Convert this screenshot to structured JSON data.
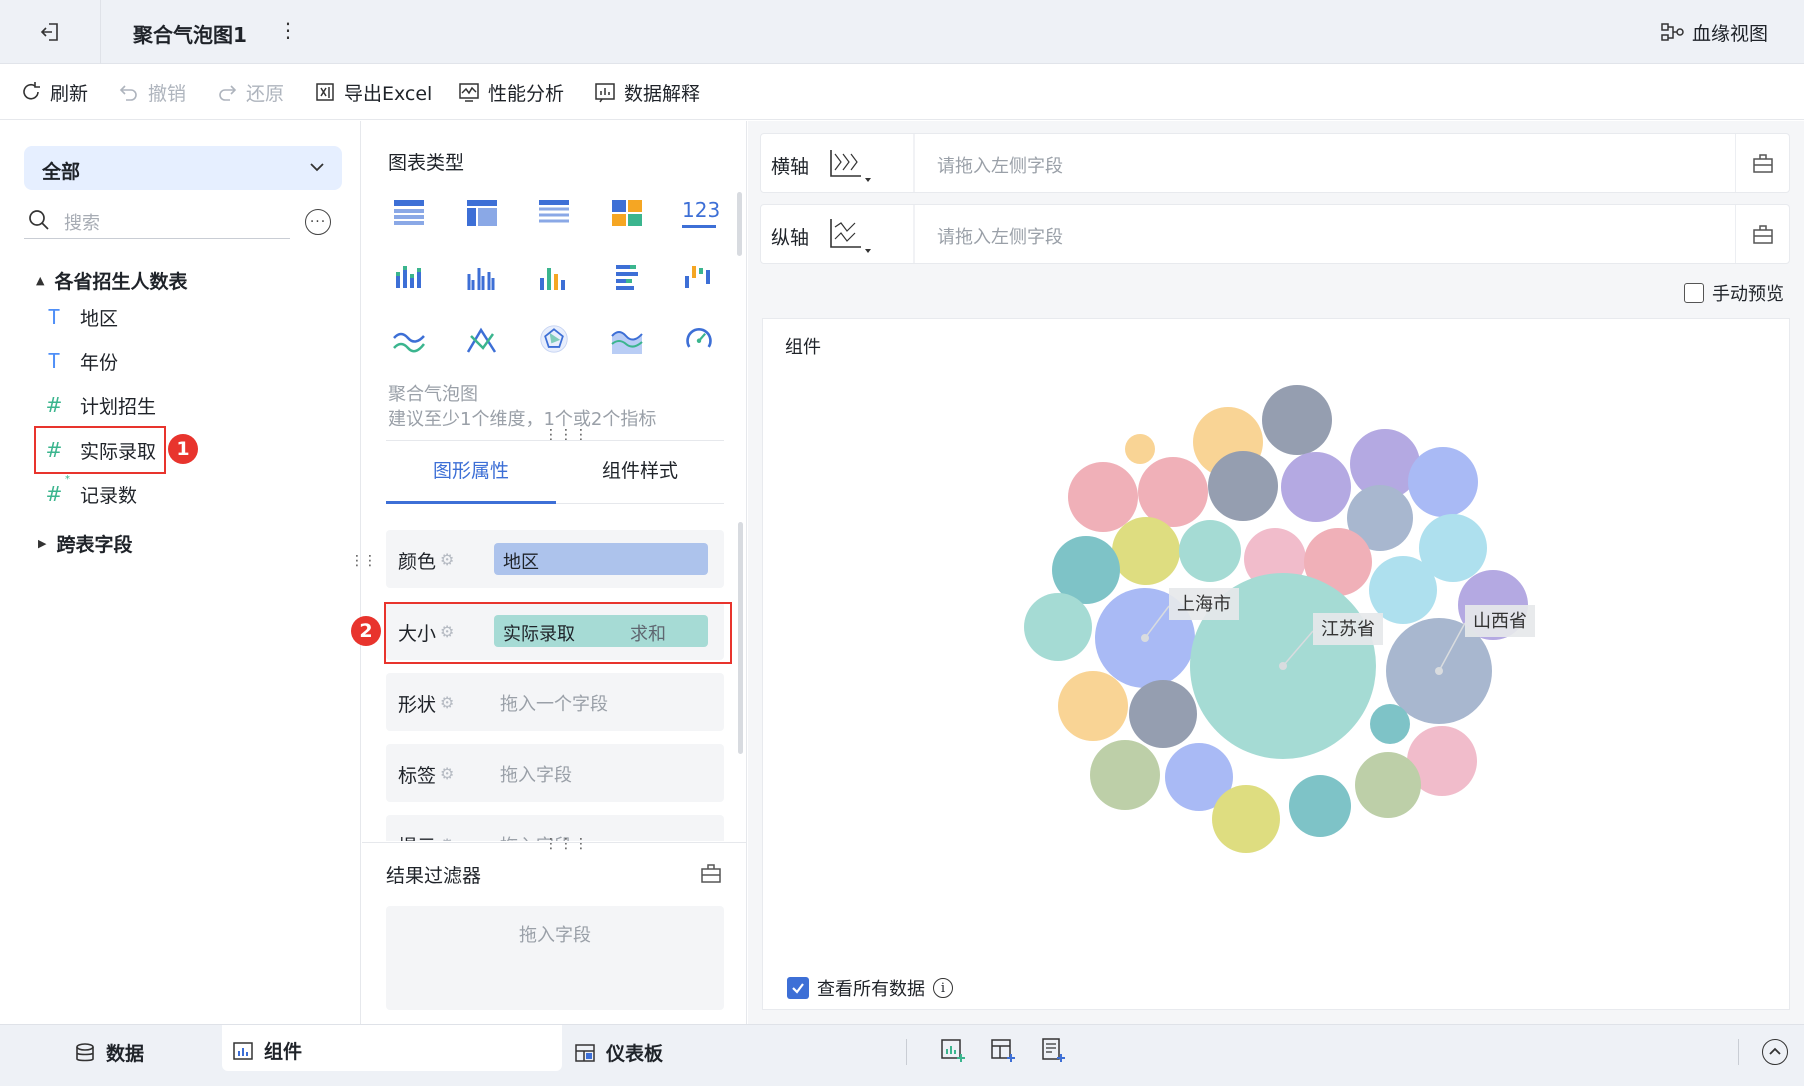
{
  "header": {
    "title": "聚合气泡图1",
    "lineage_label": "血缘视图"
  },
  "toolbar": {
    "refresh": "刷新",
    "undo": "撤销",
    "redo": "还原",
    "export_excel": "导出Excel",
    "performance": "性能分析",
    "data_explain": "数据解释"
  },
  "left": {
    "dropdown_value": "全部",
    "search_placeholder": "搜索",
    "table_name": "各省招生人数表",
    "fields": [
      {
        "label": "地区",
        "type": "text"
      },
      {
        "label": "年份",
        "type": "text"
      },
      {
        "label": "计划招生",
        "type": "number"
      },
      {
        "label": "实际录取",
        "type": "number"
      },
      {
        "label": "记录数",
        "type": "number"
      }
    ],
    "cross_table": "跨表字段",
    "badge1": "1"
  },
  "middle": {
    "chart_type_title": "图表类型",
    "chart_name": "聚合气泡图",
    "chart_hint": "建议至少1个维度，1个或2个指标",
    "tabs": [
      "图形属性",
      "组件样式"
    ],
    "props": {
      "color_label": "颜色",
      "color_value": "地区",
      "size_label": "大小",
      "size_value": "实际录取",
      "size_agg": "求和",
      "shape_label": "形状",
      "shape_ph": "拖入一个字段",
      "label_label": "标签",
      "label_ph": "拖入字段",
      "tooltip_label": "提示",
      "tooltip_ph": "拖入字段"
    },
    "badge2": "2",
    "filter_title": "结果过滤器",
    "filter_ph": "拖入字段"
  },
  "right": {
    "x_axis_label": "横轴",
    "y_axis_label": "纵轴",
    "axis_placeholder": "请拖入左侧字段",
    "manual_preview": "手动预览",
    "component_title": "组件",
    "view_all": "查看所有数据"
  },
  "bottom": {
    "data_tab": "数据",
    "component_tab": "组件",
    "dashboard_tab": "仪表板"
  },
  "chart_data": {
    "type": "bubble",
    "labels": [
      "上海市",
      "江苏省",
      "山西省"
    ],
    "palette": [
      "#a5dbd4",
      "#a8b7cf",
      "#a9baf5",
      "#f1bccb",
      "#f9d495",
      "#959eb0",
      "#b4a9e2",
      "#dedd80",
      "#7ec3c7",
      "#bdcfa8",
      "#aee0ee",
      "#f0b0b8"
    ]
  }
}
